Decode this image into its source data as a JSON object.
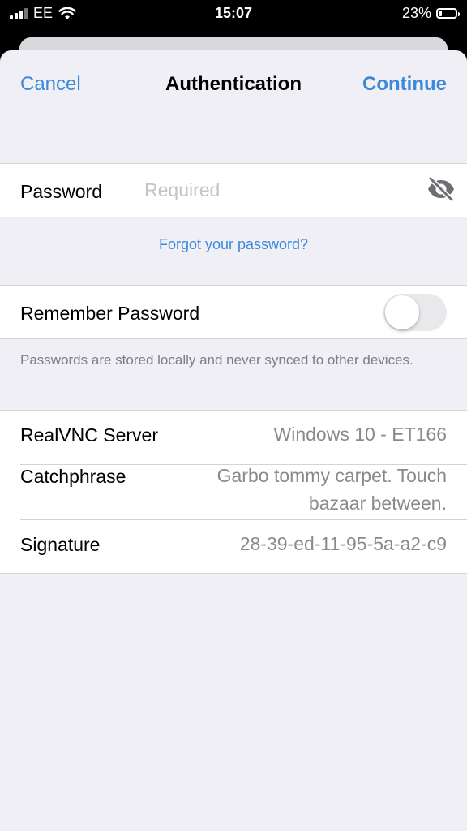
{
  "status_bar": {
    "carrier": "EE",
    "time": "15:07",
    "battery_percent": "23%",
    "battery_level": 0.23,
    "icons": [
      "signal-icon",
      "wifi-icon",
      "battery-icon"
    ]
  },
  "nav": {
    "cancel": "Cancel",
    "title": "Authentication",
    "continue": "Continue"
  },
  "password": {
    "label": "Password",
    "placeholder": "Required",
    "value": "",
    "toggle_icon": "eye-slash-icon"
  },
  "forgot_link": "Forgot your password?",
  "remember": {
    "label": "Remember Password",
    "enabled": false
  },
  "remember_footnote": "Passwords are stored locally and never synced to other devices.",
  "info": {
    "server_label": "RealVNC Server",
    "server_value": "Windows 10 - ET166",
    "catchphrase_label": "Catchphrase",
    "catchphrase_value_line1": "Garbo tommy carpet. Touch",
    "catchphrase_value_line2": "bazaar between.",
    "signature_label": "Signature",
    "signature_value": "28-39-ed-11-95-5a-a2-c9"
  },
  "colors": {
    "accent": "#3b8ad9",
    "background": "#f0eff5",
    "secondary_text": "#8a8a8e"
  }
}
